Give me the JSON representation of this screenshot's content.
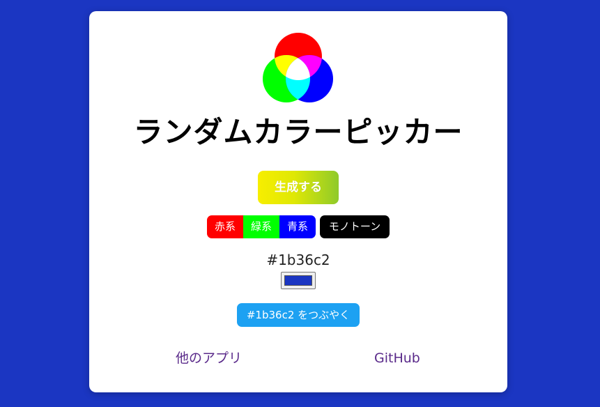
{
  "app": {
    "title": "ランダムカラーピッカー",
    "background_color": "#1b36c2"
  },
  "logo": {
    "icon": "rgb-venn-icon",
    "colors": {
      "red": "#ff0000",
      "green": "#00ff00",
      "blue": "#0000ff",
      "yellow": "#ffff00",
      "magenta": "#ff00ff",
      "cyan": "#00ffff",
      "white": "#ffffff"
    }
  },
  "actions": {
    "generate_label": "生成する"
  },
  "filters": {
    "red_label": "赤系",
    "green_label": "緑系",
    "blue_label": "青系",
    "mono_label": "モノトーン"
  },
  "current": {
    "hex": "#1b36c2",
    "swatch_color": "#1b36c2"
  },
  "share": {
    "tweet_label": "#1b36c2 をつぶやく"
  },
  "footer": {
    "other_apps_label": "他のアプリ",
    "github_label": "GitHub"
  }
}
